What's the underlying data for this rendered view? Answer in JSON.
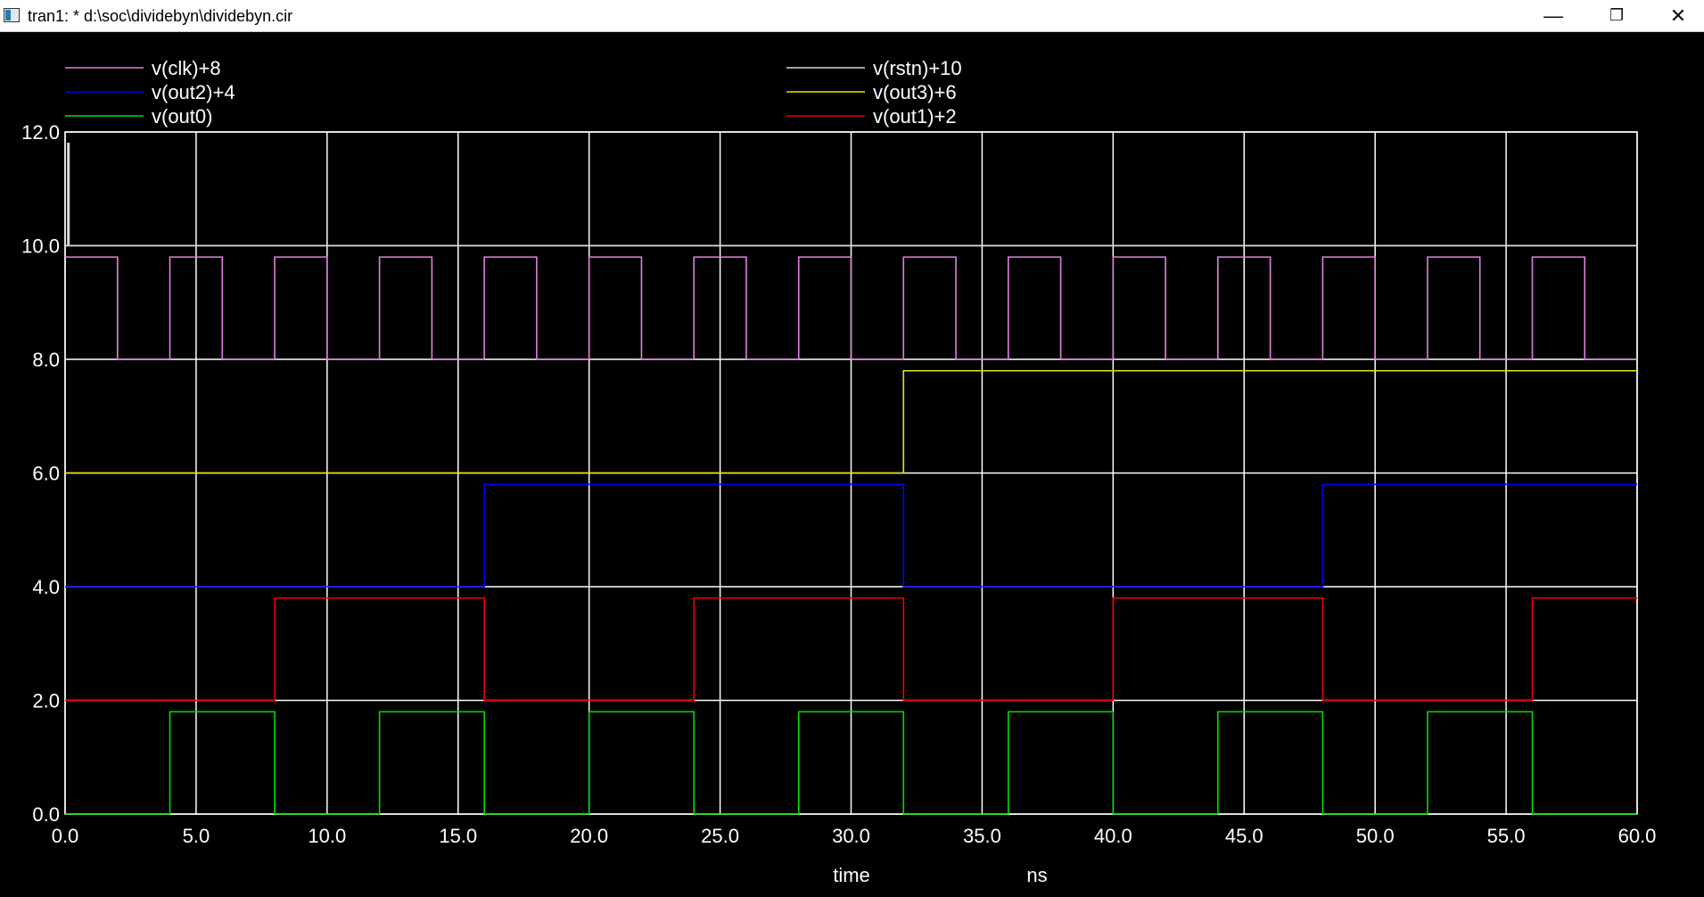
{
  "window": {
    "title": "tran1: * d:\\soc\\dividebyn\\dividebyn.cir",
    "minimize_icon": "minimize-icon",
    "restore_icon": "restore-icon",
    "close_icon": "close-icon"
  },
  "chart_data": {
    "type": "line",
    "title": "",
    "xlabel": "time",
    "xunit": "ns",
    "ylabel": "",
    "xlim": [
      0,
      60
    ],
    "ylim": [
      0,
      12
    ],
    "x_ticks": [
      0,
      5,
      10,
      15,
      20,
      25,
      30,
      35,
      40,
      45,
      50,
      55,
      60
    ],
    "y_ticks": [
      0,
      2,
      4,
      6,
      8,
      10,
      12
    ],
    "tick_decimals": 1,
    "grid": true,
    "background": "#000000",
    "grid_color": "#ffffff",
    "legend": {
      "placement": "top"
    },
    "series": [
      {
        "name": "v(clk)+8",
        "color": "#e080e0",
        "base": 8,
        "high": 1.8,
        "transitions": [
          0,
          2,
          4,
          6,
          8,
          10,
          12,
          14,
          16,
          18,
          20,
          22,
          24,
          26,
          28,
          30,
          32,
          34,
          36,
          38,
          40,
          42,
          44,
          46,
          48,
          50,
          52,
          54,
          56,
          58
        ],
        "start_high": true
      },
      {
        "name": "v(rstn)+10",
        "color": "#d8d8d8",
        "points": [
          [
            0,
            10
          ],
          [
            0.1,
            10
          ],
          [
            0.1,
            11.8
          ],
          [
            0.15,
            11.8
          ],
          [
            0.15,
            10
          ],
          [
            60,
            10
          ]
        ]
      },
      {
        "name": "v(out2)+4",
        "color": "#0000ff",
        "base": 4,
        "high": 1.8,
        "transitions": [
          16,
          32,
          48
        ],
        "start_high": false
      },
      {
        "name": "v(out3)+6",
        "color": "#e6e600",
        "base": 6,
        "high": 1.8,
        "transitions": [
          32
        ],
        "start_high": false
      },
      {
        "name": "v(out0)",
        "color": "#00dd00",
        "base": 0,
        "high": 1.8,
        "transitions": [
          4,
          8,
          12,
          16,
          20,
          24,
          28,
          32,
          36,
          40,
          44,
          48,
          52,
          56
        ],
        "start_high": false
      },
      {
        "name": "v(out1)+2",
        "color": "#ee0000",
        "base": 2,
        "high": 1.8,
        "transitions": [
          8,
          16,
          24,
          32,
          40,
          48,
          56
        ],
        "start_high": false
      }
    ]
  }
}
